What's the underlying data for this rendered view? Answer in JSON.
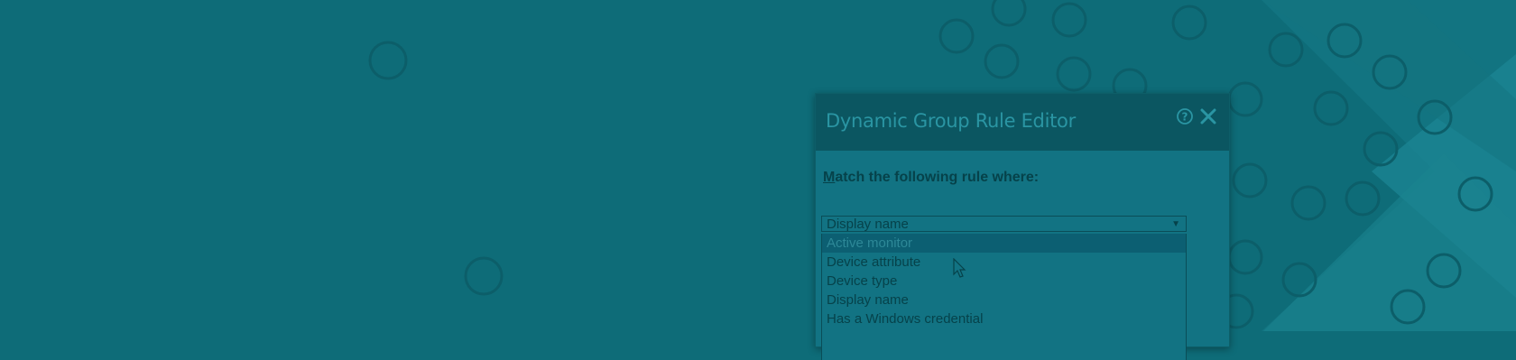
{
  "dialog": {
    "title": "Dynamic Group Rule Editor",
    "rule_label_first": "M",
    "rule_label_rest": "atch the following rule where:",
    "selected_value": "Display name",
    "options": [
      "Active monitor",
      "Device attribute",
      "Device type",
      "Display name",
      "Has a Windows credential"
    ],
    "highlighted_option": "Active monitor"
  },
  "icons": {
    "help": "help-icon",
    "close": "close-icon",
    "dropdown": "chevron-down-icon",
    "pointer": "mouse-pointer-icon"
  },
  "colors": {
    "background": "#0e6c78",
    "dialog_header": "#0b5661",
    "title_text": "#2a95a3",
    "body_text": "#06424a",
    "highlight": "#0c5f72"
  }
}
